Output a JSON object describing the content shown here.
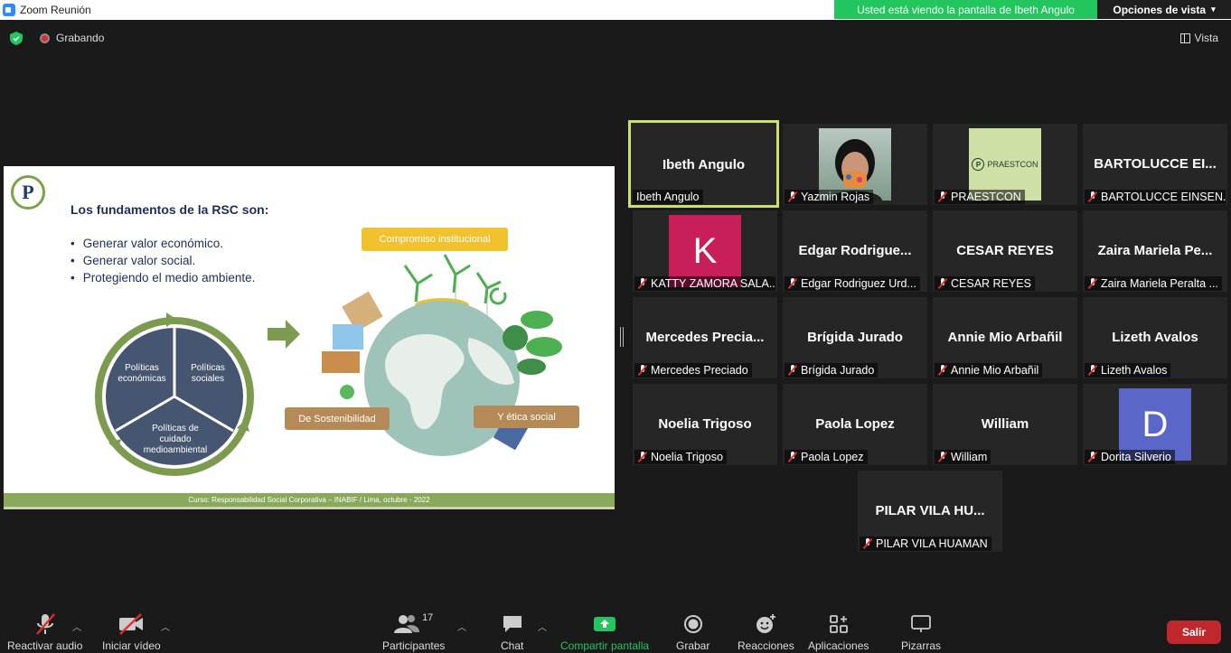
{
  "window": {
    "title": "Zoom Reunión"
  },
  "banner": {
    "text": "Usted está viendo la pantalla de Ibeth Angulo",
    "view_options": "Opciones de vista",
    "color": "#22c55e"
  },
  "topbar": {
    "recording": "Grabando",
    "view": "Vista"
  },
  "slide": {
    "logo_letter": "P",
    "heading": "Los fundamentos de la RSC son:",
    "bullets": [
      "Generar valor económico.",
      "Generar valor social.",
      "Protegiendo el medio ambiente."
    ],
    "cycle": {
      "left": "Políticas económicas",
      "right": "Políticas sociales",
      "bottom": "Políticas de cuidado medioambiental"
    },
    "pills": {
      "top": "Compromiso institucional",
      "left": "De Sostenibilidad",
      "right": "Y ética social"
    },
    "footer": "Curso: Responsabilidad Social Corporativa – INABIF / Lima, octubre - 2022"
  },
  "participants": [
    {
      "center": "Ibeth Angulo",
      "label": "Ibeth Angulo",
      "active": true,
      "muted": false
    },
    {
      "center": "",
      "label": "Yazmin Rojas",
      "photo": "person",
      "muted": true
    },
    {
      "center": "",
      "label": "PRAESTCON",
      "photo": "praestcon",
      "photo_text": "PRAESTCON",
      "muted": true
    },
    {
      "center": "BARTOLUCCE EI...",
      "label": "BARTOLUCCE EINSEN...",
      "muted": true
    },
    {
      "center": "",
      "label": "KATTY ZAMORA SALA...",
      "avatar_letter": "K",
      "avatar_color": "#c81e5a",
      "muted": true
    },
    {
      "center": "Edgar  Rodrigue...",
      "label": "Edgar Rodriguez Urd...",
      "muted": true
    },
    {
      "center": "CESAR REYES",
      "label": "CESAR REYES",
      "muted": true
    },
    {
      "center": "Zaira  Mariela  Pe...",
      "label": "Zaira Mariela Peralta ...",
      "muted": true
    },
    {
      "center": "Mercedes  Precia...",
      "label": "Mercedes Preciado",
      "muted": true
    },
    {
      "center": "Brígida Jurado",
      "label": "Brígida Jurado",
      "muted": true
    },
    {
      "center": "Annie Mio Arbañil",
      "label": "Annie Mio Arbañil",
      "muted": true
    },
    {
      "center": "Lizeth Avalos",
      "label": "Lizeth Avalos",
      "muted": true
    },
    {
      "center": "Noelia Trigoso",
      "label": "Noelia Trigoso",
      "muted": true
    },
    {
      "center": "Paola Lopez",
      "label": "Paola Lopez",
      "muted": true
    },
    {
      "center": "William",
      "label": "William",
      "muted": true
    },
    {
      "center": "",
      "label": "Dorita Silverio",
      "avatar_letter": "D",
      "avatar_color": "#5a67c8",
      "muted": true
    },
    {
      "center": "PILAR VILA HU...",
      "label": "PILAR VILA HUAMAN",
      "muted": true
    }
  ],
  "toolbar": {
    "audio": "Reactivar audio",
    "video": "Iniciar vídeo",
    "participants": "Participantes",
    "participants_count": "17",
    "chat": "Chat",
    "share": "Compartir pantalla",
    "record": "Grabar",
    "reactions": "Reacciones",
    "apps": "Aplicaciones",
    "whiteboards": "Pizarras",
    "leave": "Salir",
    "share_color": "#22c55e",
    "leave_color": "#c0282d"
  }
}
